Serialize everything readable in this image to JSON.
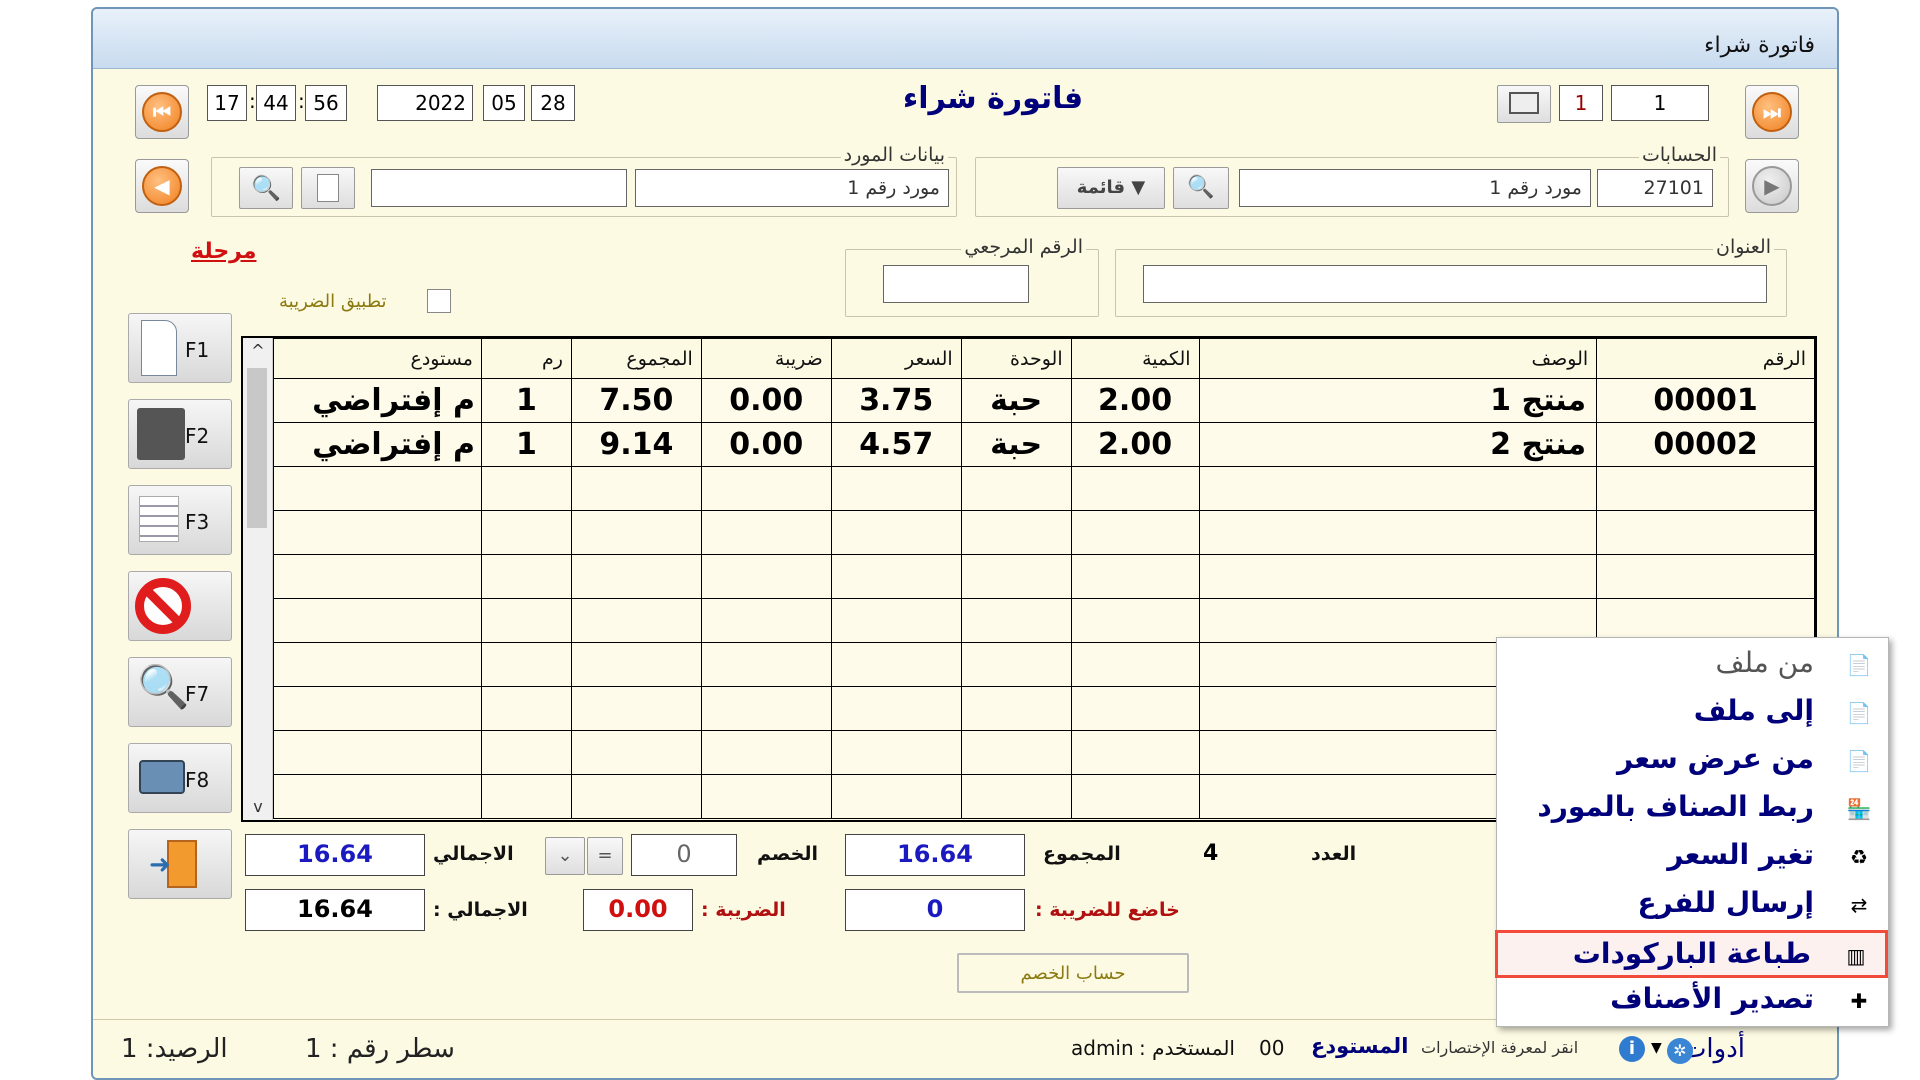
{
  "window": {
    "title": "فاتورة شراء"
  },
  "header": {
    "form_title": "فاتورة شراء",
    "time": {
      "h": "17",
      "m": "44",
      "s": "56"
    },
    "date": {
      "y": "2022",
      "mo": "05",
      "d": "28"
    },
    "record_no": "1",
    "page_no": "1"
  },
  "supplier": {
    "label": "بيانات المورد",
    "name": "مورد رقم 1",
    "extra": ""
  },
  "accounts": {
    "label": "الحسابات",
    "code": "27101",
    "name": "مورد رقم 1",
    "list_button": "قائمة"
  },
  "stage_link": "مرحلة",
  "reference": {
    "label": "الرقم المرجعي",
    "value": ""
  },
  "address": {
    "label": "العنوان",
    "value": ""
  },
  "apply_tax": "تطبيق الضريبة",
  "function_keys": [
    "F1",
    "F2",
    "F3",
    "F7",
    "F8"
  ],
  "grid": {
    "columns": [
      "الرقم",
      "الوصف",
      "الكمية",
      "الوحدة",
      "السعر",
      "ضريبة",
      "المجموع",
      "رم",
      "مستودع"
    ],
    "rows": [
      [
        "00001",
        "منتج 1",
        "2.00",
        "حبة",
        "3.75",
        "0.00",
        "7.50",
        "1",
        "م إفتراضي"
      ],
      [
        "00002",
        "منتج 2",
        "2.00",
        "حبة",
        "4.57",
        "0.00",
        "9.14",
        "1",
        "م إفتراضي"
      ]
    ]
  },
  "totals": {
    "count_label": "العدد",
    "count": "4",
    "sum_label": "المجموع",
    "sum": "16.64",
    "discount_label": "الخصم",
    "discount": "0",
    "discount_op": "=",
    "total_label": "الاجمالي",
    "total": "16.64",
    "taxable_label": "خاضع للضريبة :",
    "taxable": "0",
    "tax_label": "الضريبة :",
    "tax": "0.00",
    "grand_label": "الاجمالي :",
    "grand": "16.64",
    "calc_discount_button": "حساب الخصم"
  },
  "status": {
    "tools": "أدوات",
    "shortcuts_hint": "انقر لمعرفة الإختصارات",
    "warehouse_label": "المستودع",
    "warehouse": "00",
    "user_label": "المستخدم :",
    "user": "admin",
    "line_no": "سطر رقم : 1",
    "balance": "الرصيد: 1"
  },
  "menu": {
    "items": [
      {
        "label": "من ملف",
        "icon": "import-file-icon",
        "disabled": true
      },
      {
        "label": "إلى ملف",
        "icon": "export-file-icon",
        "disabled": false
      },
      {
        "label": "من عرض سعر",
        "icon": "from-quote-icon",
        "disabled": false
      },
      {
        "label": "ربط الصناف بالمورد",
        "icon": "store-link-icon",
        "disabled": false
      },
      {
        "label": "تغير السعر",
        "icon": "price-change-icon",
        "disabled": false
      },
      {
        "label": "إرسال للفرع",
        "icon": "send-branch-icon",
        "disabled": false
      },
      {
        "label": "طباعة الباركودات",
        "icon": "barcode-icon",
        "disabled": false,
        "highlighted": true
      },
      {
        "label": "تصدير الأصناف",
        "icon": "export-items-icon",
        "disabled": false
      }
    ]
  }
}
